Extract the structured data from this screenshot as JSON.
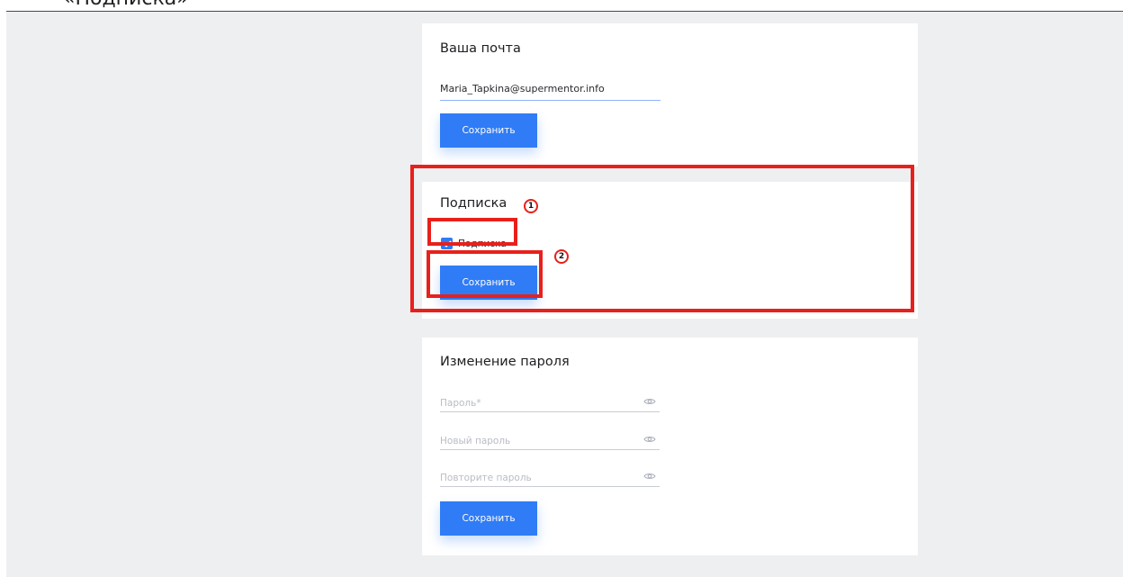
{
  "doc_caption": "«Подписка»",
  "email_section": {
    "title": "Ваша почта",
    "email_value": "Maria_Tapkina@supermentor.info",
    "save_label": "Сохранить"
  },
  "subscription_section": {
    "title": "Подписка",
    "checkbox_label": "Подписка",
    "checkbox_checked": true,
    "save_label": "Сохранить"
  },
  "password_section": {
    "title": "Изменение пароля",
    "fields": [
      {
        "placeholder": "Пароль*",
        "icon": "eye-icon"
      },
      {
        "placeholder": "Новый пароль",
        "icon": "eye-icon"
      },
      {
        "placeholder": "Повторите пароль",
        "icon": "eye-icon"
      }
    ],
    "save_label": "Сохранить"
  },
  "annotations": {
    "markers": [
      "1",
      "2"
    ],
    "highlight_color": "#e8201b"
  },
  "colors": {
    "accent": "#2f7cf6",
    "page_bg": "#eeeff1",
    "card_bg": "#ffffff"
  }
}
